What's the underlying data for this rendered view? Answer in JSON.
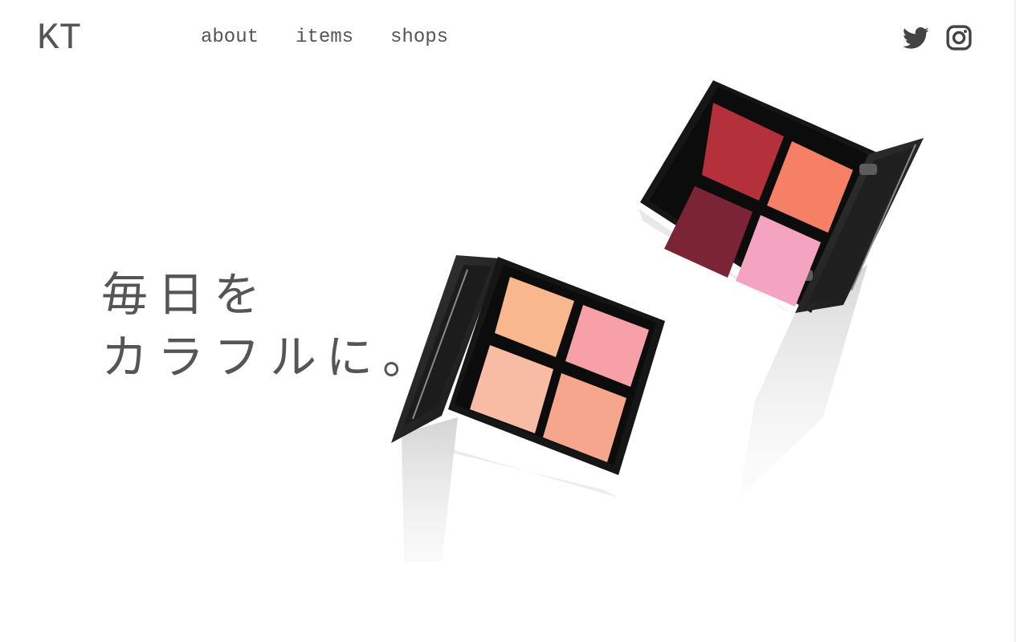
{
  "header": {
    "logo": "KT",
    "nav": [
      {
        "label": "about"
      },
      {
        "label": "items"
      },
      {
        "label": "shops"
      }
    ],
    "social": [
      {
        "icon": "twitter-icon"
      },
      {
        "icon": "instagram-icon"
      }
    ]
  },
  "hero": {
    "line1": "毎日を",
    "line2": "カラフルに。"
  },
  "palettes": {
    "warm_colors": [
      "#f9b78e",
      "#f7a0a8",
      "#f8bba4",
      "#f5a68c"
    ],
    "berry_colors": [
      "#b4303a",
      "#f58066",
      "#7a2436",
      "#f4a3c0"
    ]
  }
}
